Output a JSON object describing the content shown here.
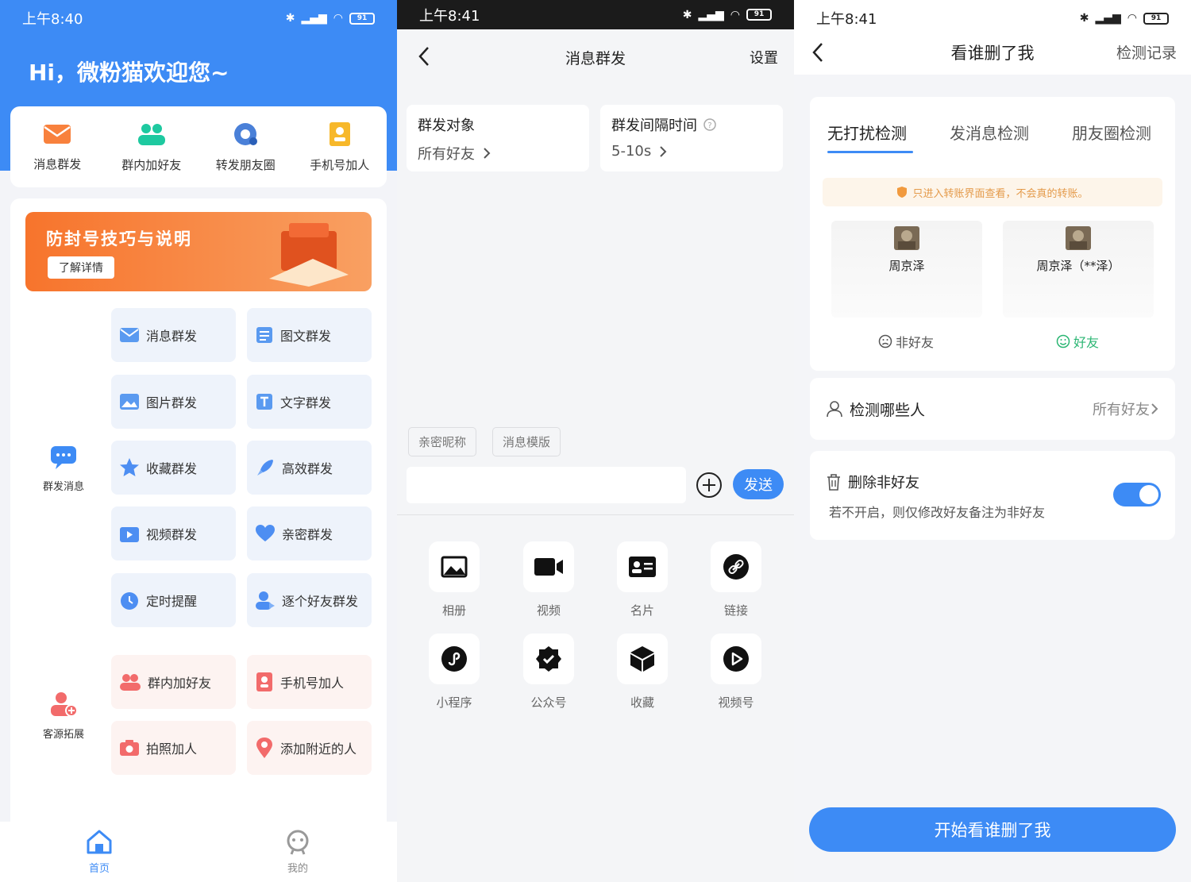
{
  "panel1": {
    "status": {
      "time": "上午8:40",
      "battery": "91"
    },
    "greeting": "Hi，微粉猫欢迎您~",
    "quick_actions": [
      {
        "label": "消息群发",
        "icon": "envelope-icon"
      },
      {
        "label": "群内加好友",
        "icon": "group-users-icon"
      },
      {
        "label": "转发朋友圈",
        "icon": "moments-share-icon"
      },
      {
        "label": "手机号加人",
        "icon": "phonebook-icon"
      }
    ],
    "banner": {
      "title": "防封号技巧与说明",
      "button": "了解详情"
    },
    "section_mass": {
      "label": "群发消息",
      "icon": "chat-bubble-icon"
    },
    "mass_items": [
      {
        "label": "消息群发",
        "icon": "envelope-icon"
      },
      {
        "label": "图文群发",
        "icon": "article-icon"
      },
      {
        "label": "图片群发",
        "icon": "image-icon"
      },
      {
        "label": "文字群发",
        "icon": "text-icon"
      },
      {
        "label": "收藏群发",
        "icon": "star-icon"
      },
      {
        "label": "高效群发",
        "icon": "rocket-icon"
      },
      {
        "label": "视频群发",
        "icon": "video-icon"
      },
      {
        "label": "亲密群发",
        "icon": "heart-icon"
      },
      {
        "label": "定时提醒",
        "icon": "alarm-clock-icon"
      },
      {
        "label": "逐个好友群发",
        "icon": "user-send-icon"
      }
    ],
    "section_source": {
      "label": "客源拓展",
      "icon": "add-user-icon"
    },
    "source_items": [
      {
        "label": "群内加好友",
        "icon": "group-users-icon"
      },
      {
        "label": "手机号加人",
        "icon": "phonebook-icon"
      },
      {
        "label": "拍照加人",
        "icon": "camera-icon"
      },
      {
        "label": "添加附近的人",
        "icon": "location-pin-icon"
      }
    ],
    "tabbar": [
      {
        "label": "首页",
        "icon": "home-icon",
        "active": true
      },
      {
        "label": "我的",
        "icon": "profile-face-icon",
        "active": false
      }
    ]
  },
  "panel2": {
    "status": {
      "time": "上午8:41",
      "battery": "91"
    },
    "title": "消息群发",
    "settings": "设置",
    "target": {
      "label": "群发对象",
      "value": "所有好友"
    },
    "interval": {
      "label": "群发间隔时间",
      "value": "5-10s"
    },
    "chips": [
      "亲密昵称",
      "消息模版"
    ],
    "send": "发送",
    "tools": [
      {
        "label": "相册",
        "icon": "album-icon"
      },
      {
        "label": "视频",
        "icon": "video-camera-icon"
      },
      {
        "label": "名片",
        "icon": "business-card-icon"
      },
      {
        "label": "链接",
        "icon": "link-icon"
      },
      {
        "label": "小程序",
        "icon": "mini-program-icon"
      },
      {
        "label": "公众号",
        "icon": "official-account-icon"
      },
      {
        "label": "收藏",
        "icon": "cube-icon"
      },
      {
        "label": "视频号",
        "icon": "play-icon"
      }
    ]
  },
  "panel3": {
    "status": {
      "time": "上午8:41",
      "battery": "91"
    },
    "title": "看谁删了我",
    "record": "检测记录",
    "tabs": [
      "无打扰检测",
      "发消息检测",
      "朋友圈检测"
    ],
    "tip": "只进入转账界面查看，不会真的转账。",
    "friends": [
      {
        "name": "周京泽",
        "status": "非好友"
      },
      {
        "name": "周京泽（**泽）",
        "status": "好友"
      }
    ],
    "who": {
      "label": "检测哪些人",
      "value": "所有好友"
    },
    "delete": {
      "title": "删除非好友",
      "desc": "若不开启，则仅修改好友备注为非好友"
    },
    "start": "开始看谁删了我",
    "colors": {
      "accent": "#3d8bf5",
      "ok": "#2bb673",
      "warn": "#e49a4a"
    }
  }
}
